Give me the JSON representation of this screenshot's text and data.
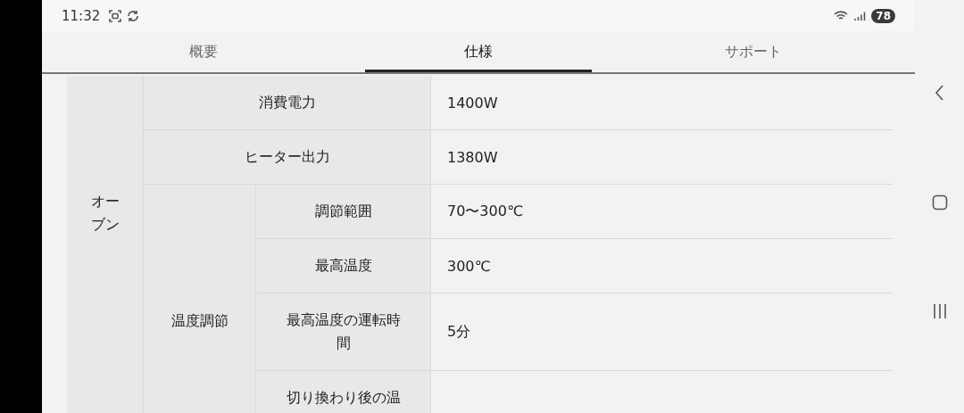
{
  "status_bar": {
    "time": "11:32",
    "battery": "78"
  },
  "tabs": [
    {
      "label": "概要",
      "selected": false
    },
    {
      "label": "仕様",
      "selected": true
    },
    {
      "label": "サポート",
      "selected": false
    }
  ],
  "spec_table": {
    "category": "オーブン",
    "rows": [
      {
        "kind": "single",
        "label": "消費電力",
        "value": "1400W"
      },
      {
        "kind": "single",
        "label": "ヒーター出力",
        "value": "1380W"
      },
      {
        "kind": "group",
        "label": "温度調節",
        "children": [
          {
            "label": "調節範囲",
            "value": "70〜300℃"
          },
          {
            "label": "最高温度",
            "value": "300℃"
          },
          {
            "label": "最高温度の運転時間",
            "value": "5分"
          },
          {
            "label": "切り換わり後の温"
          }
        ]
      }
    ]
  }
}
